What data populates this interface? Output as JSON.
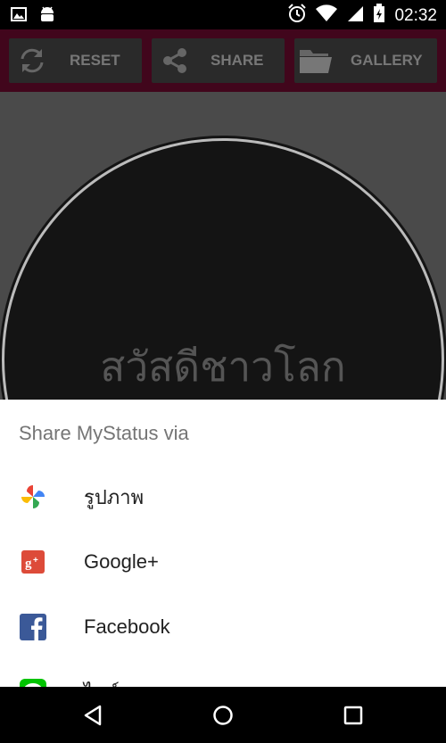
{
  "status_bar": {
    "time": "02:32",
    "icons": [
      "image-icon",
      "android-icon",
      "alarm-icon",
      "wifi-icon",
      "signal-icon",
      "battery-icon"
    ]
  },
  "toolbar": {
    "reset_label": "RESET",
    "share_label": "SHARE",
    "gallery_label": "GALLERY",
    "background_color": "#41061c"
  },
  "content": {
    "circle_text": "สวัสดีชาวโลก"
  },
  "share_sheet": {
    "title": "Share MyStatus via",
    "items": [
      {
        "label": "รูปภาพ",
        "icon": "google-photos-icon"
      },
      {
        "label": "Google+",
        "icon": "google-plus-icon"
      },
      {
        "label": "Facebook",
        "icon": "facebook-icon"
      },
      {
        "label": "ไลน์",
        "icon": "line-icon"
      }
    ]
  },
  "nav_bar": {
    "buttons": [
      "back-icon",
      "home-icon",
      "recents-icon"
    ]
  }
}
